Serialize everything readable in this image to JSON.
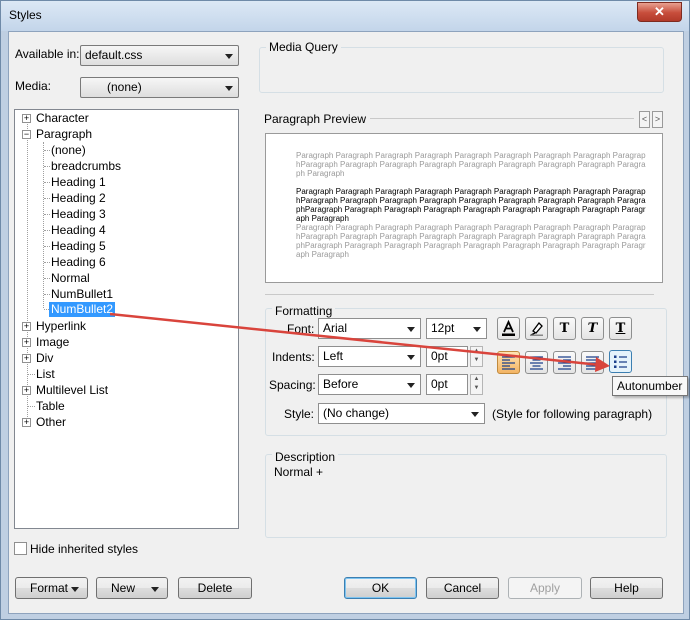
{
  "window": {
    "title": "Styles",
    "close_glyph": "✕"
  },
  "left": {
    "available_label": "Available in:",
    "available_value": "default.css",
    "media_label": "Media:",
    "media_value": "(none)"
  },
  "tree": {
    "top": [
      {
        "label": "Character",
        "expander": "+"
      },
      {
        "label": "Paragraph",
        "expander": "−"
      }
    ],
    "paragraph_children": [
      "(none)",
      "breadcrumbs",
      "Heading 1",
      "Heading 2",
      "Heading 3",
      "Heading 4",
      "Heading 5",
      "Heading 6",
      "Normal",
      "NumBullet1",
      "NumBullet2"
    ],
    "selected": "NumBullet2",
    "bottom": [
      {
        "label": "Hyperlink",
        "expander": "+"
      },
      {
        "label": "Image",
        "expander": "+"
      },
      {
        "label": "Div",
        "expander": "+"
      },
      {
        "label": "List",
        "expander": ""
      },
      {
        "label": "Multilevel List",
        "expander": "+"
      },
      {
        "label": "Table",
        "expander": ""
      },
      {
        "label": "Other",
        "expander": "+"
      }
    ]
  },
  "hide_inherited_label": "Hide inherited styles",
  "media_query_label": "Media Query",
  "preview": {
    "label": "Paragraph Preview",
    "prev_glyph": "<",
    "next_glyph": ">",
    "before_text": "Paragraph Paragraph Paragraph Paragraph Paragraph Paragraph Paragraph Paragraph ParagraphParagraph Paragraph Paragraph Paragraph Paragraph Paragraph Paragraph Paragraph Paragraph Paragraph",
    "current_text": "Paragraph Paragraph Paragraph Paragraph Paragraph Paragraph Paragraph Paragraph ParagraphParagraph Paragraph Paragraph Paragraph Paragraph Paragraph Paragraph Paragraph ParagraphParagraph Paragraph Paragraph Paragraph Paragraph Paragraph Paragraph Paragraph Paragraph Paragraph",
    "after_text": "Paragraph Paragraph Paragraph Paragraph Paragraph Paragraph Paragraph Paragraph ParagraphParagraph Paragraph Paragraph Paragraph Paragraph Paragraph Paragraph Paragraph ParagraphParagraph Paragraph Paragraph Paragraph Paragraph Paragraph Paragraph Paragraph Paragraph Paragraph"
  },
  "formatting": {
    "label": "Formatting",
    "font_label": "Font:",
    "font_value": "Arial",
    "size_value": "12pt",
    "indents_label": "Indents:",
    "indents_value": "Left",
    "indents_amount": "0pt",
    "spacing_label": "Spacing:",
    "spacing_value": "Before",
    "spacing_amount": "0pt",
    "style_label": "Style:",
    "style_value": "(No change)",
    "style_hint": "(Style for following paragraph)",
    "text_buttons": [
      "T",
      "T",
      "T"
    ],
    "tooltip": "Autonumber"
  },
  "description": {
    "label": "Description",
    "text": "Normal +"
  },
  "buttons": {
    "format": "Format",
    "new": "New",
    "delete": "Delete",
    "ok": "OK",
    "cancel": "Cancel",
    "apply": "Apply",
    "help": "Help"
  },
  "colors": {
    "selection": "#3399ff",
    "annotation_arrow": "#d9443c",
    "alignment_active": "#f3b464"
  }
}
